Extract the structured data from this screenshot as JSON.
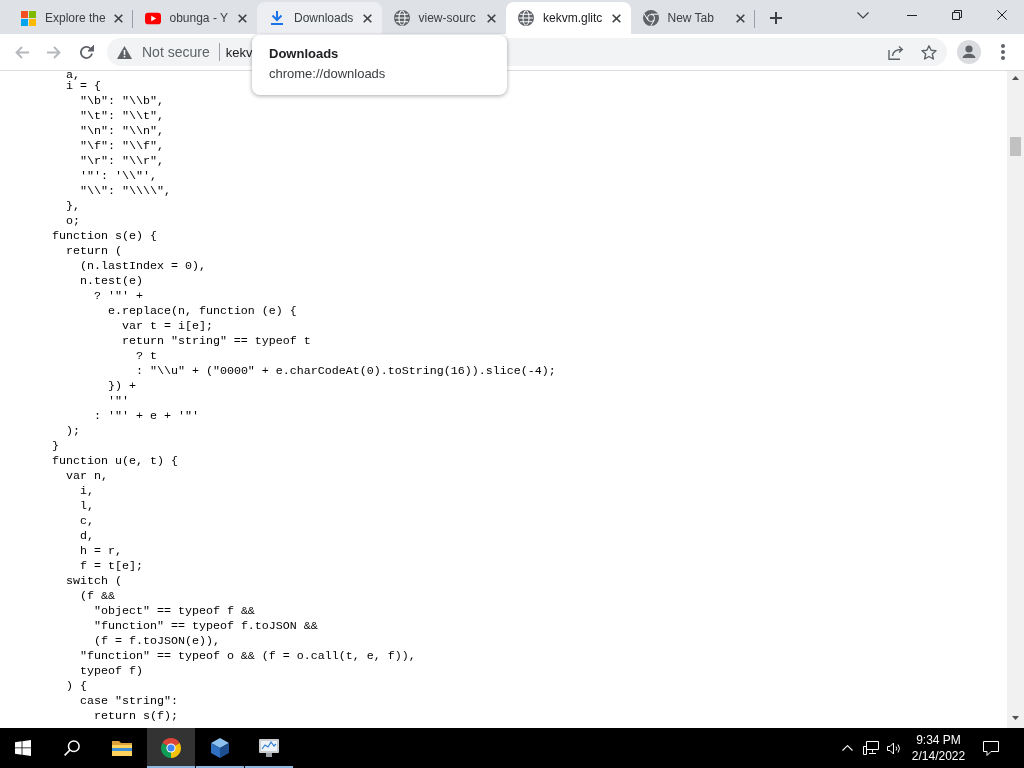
{
  "tabs": [
    {
      "title": "Explore the",
      "kind": "tiles",
      "selected": false,
      "hovered": false
    },
    {
      "title": "obunga - Y",
      "kind": "play",
      "selected": false,
      "hovered": false
    },
    {
      "title": "Downloads",
      "kind": "download",
      "selected": false,
      "hovered": true
    },
    {
      "title": "view-sourc",
      "kind": "globe",
      "selected": false,
      "hovered": false
    },
    {
      "title": "kekvm.glitc",
      "kind": "globe",
      "selected": true,
      "hovered": false
    },
    {
      "title": "New Tab",
      "kind": "ring",
      "selected": false,
      "hovered": false
    }
  ],
  "toolbar": {
    "back": {
      "disabled": true
    },
    "forward": {
      "disabled": true
    },
    "security": "Not secure",
    "url": "kekv"
  },
  "tooltip": {
    "title": "Downloads",
    "subtitle": "chrome://downloads"
  },
  "code": {
    "lines": [
      "  a,",
      "  i = {",
      "    \"\\b\": \"\\\\b\",",
      "    \"\\t\": \"\\\\t\",",
      "    \"\\n\": \"\\\\n\",",
      "    \"\\f\": \"\\\\f\",",
      "    \"\\r\": \"\\\\r\",",
      "    '\"': '\\\\\"',",
      "    \"\\\\\": \"\\\\\\\\\",",
      "  },",
      "  o;",
      "function s(e) {",
      "  return (",
      "    (n.lastIndex = 0),",
      "    n.test(e)",
      "      ? '\"' +",
      "        e.replace(n, function (e) {",
      "          var t = i[e];",
      "          return \"string\" == typeof t",
      "            ? t",
      "            : \"\\\\u\" + (\"0000\" + e.charCodeAt(0).toString(16)).slice(-4);",
      "        }) +",
      "        '\"'",
      "      : '\"' + e + '\"'",
      "  );",
      "}",
      "function u(e, t) {",
      "  var n,",
      "    i,",
      "    l,",
      "    c,",
      "    d,",
      "    h = r,",
      "    f = t[e];",
      "  switch (",
      "    (f &&",
      "      \"object\" == typeof f &&",
      "      \"function\" == typeof f.toJSON &&",
      "      (f = f.toJSON(e)),",
      "    \"function\" == typeof o && (f = o.call(t, e, f)),",
      "    typeof f)",
      "  ) {",
      "    case \"string\":",
      "      return s(f);"
    ]
  },
  "taskbar": {
    "apps": [
      {
        "kind": "folder",
        "running": false,
        "selected": false
      },
      {
        "kind": "ring",
        "running": true,
        "selected": true
      },
      {
        "kind": "cube",
        "running": true,
        "selected": false
      },
      {
        "kind": "monitor",
        "running": true,
        "selected": false
      }
    ],
    "clock": {
      "time": "9:34 PM",
      "date": "2/14/2022"
    }
  }
}
